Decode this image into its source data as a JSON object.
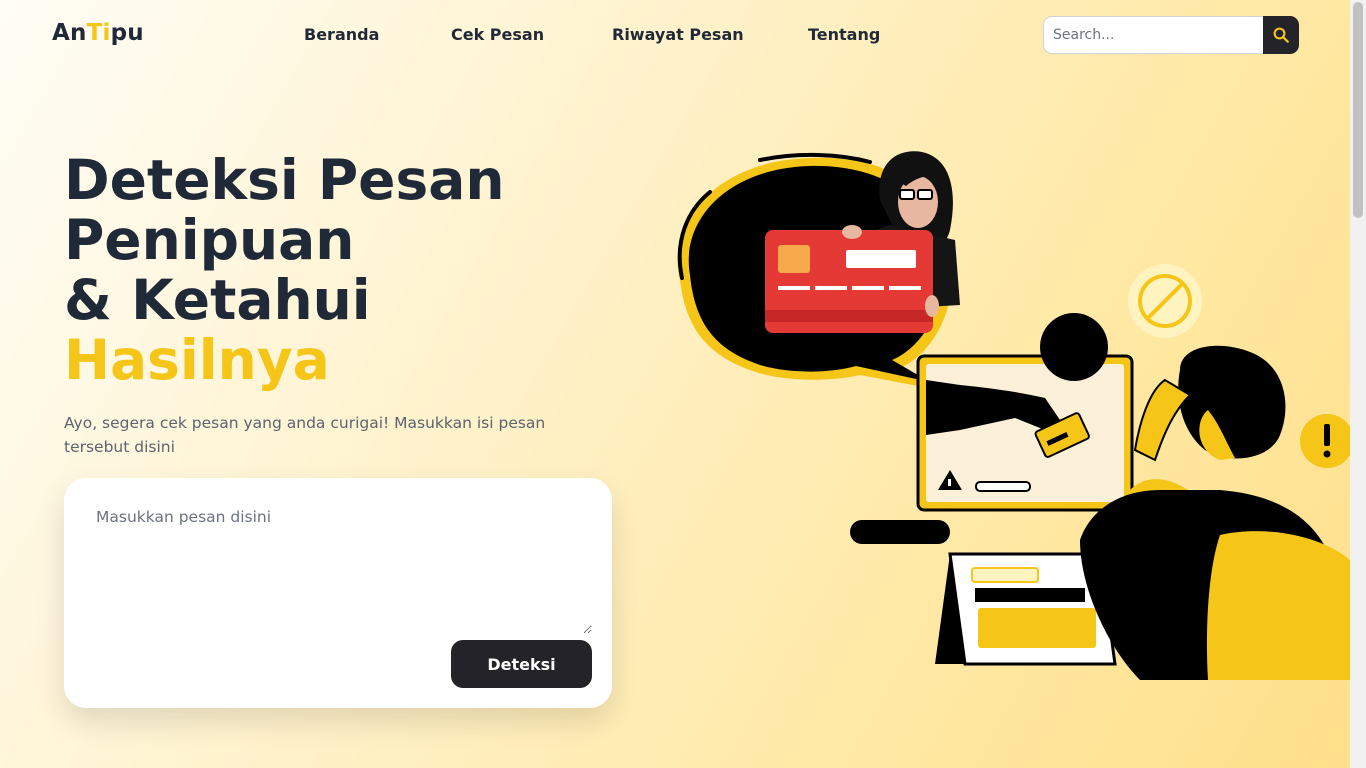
{
  "brand": {
    "part1": "An",
    "part2": "Ti",
    "part3": "pu",
    "accent_color": "#f5c518"
  },
  "nav": {
    "items": [
      {
        "label": "Beranda"
      },
      {
        "label": "Cek Pesan"
      },
      {
        "label": "Riwayat Pesan"
      },
      {
        "label": "Tentang"
      }
    ]
  },
  "search": {
    "placeholder": "Search...",
    "value": "",
    "icon": "search-icon"
  },
  "hero": {
    "title_line1": "Deteksi Pesan",
    "title_line2": "Penipuan",
    "title_line3": "& Ketahui",
    "title_line4": "Hasilnya",
    "subtitle": "Ayo, segera cek pesan yang anda curigai! Masukkan isi pesan tersebut disini"
  },
  "form": {
    "placeholder": "Masukkan pesan disini",
    "value": "",
    "button_label": "Deteksi"
  },
  "colors": {
    "dark": "#25232a",
    "text": "#1f2937",
    "yellow": "#f5c518",
    "card_red": "#e53935"
  }
}
